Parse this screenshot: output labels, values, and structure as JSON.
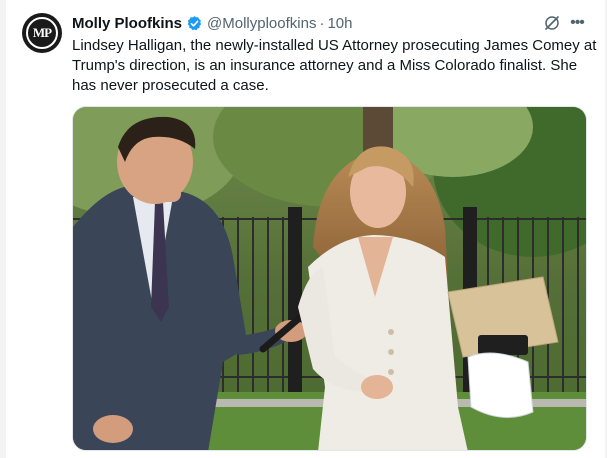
{
  "tweet": {
    "display_name": "Molly Ploofkins",
    "handle": "@Mollyploofkins",
    "separator": "·",
    "time": "10h",
    "text": "Lindsey Halligan, the newly-installed US Attorney prosecuting James Comey at Trump's direction, is an insurance attorney and a Miss Colorado finalist. She has never prosecuted a case.",
    "avatar_initials": "MP",
    "verified": true
  },
  "icons": {
    "verified": "verified-badge-icon",
    "grok": "grok-icon",
    "more": "more-icon"
  },
  "colors": {
    "verified_blue": "#1d9bf0",
    "text": "#0f1419",
    "secondary": "#536471"
  }
}
